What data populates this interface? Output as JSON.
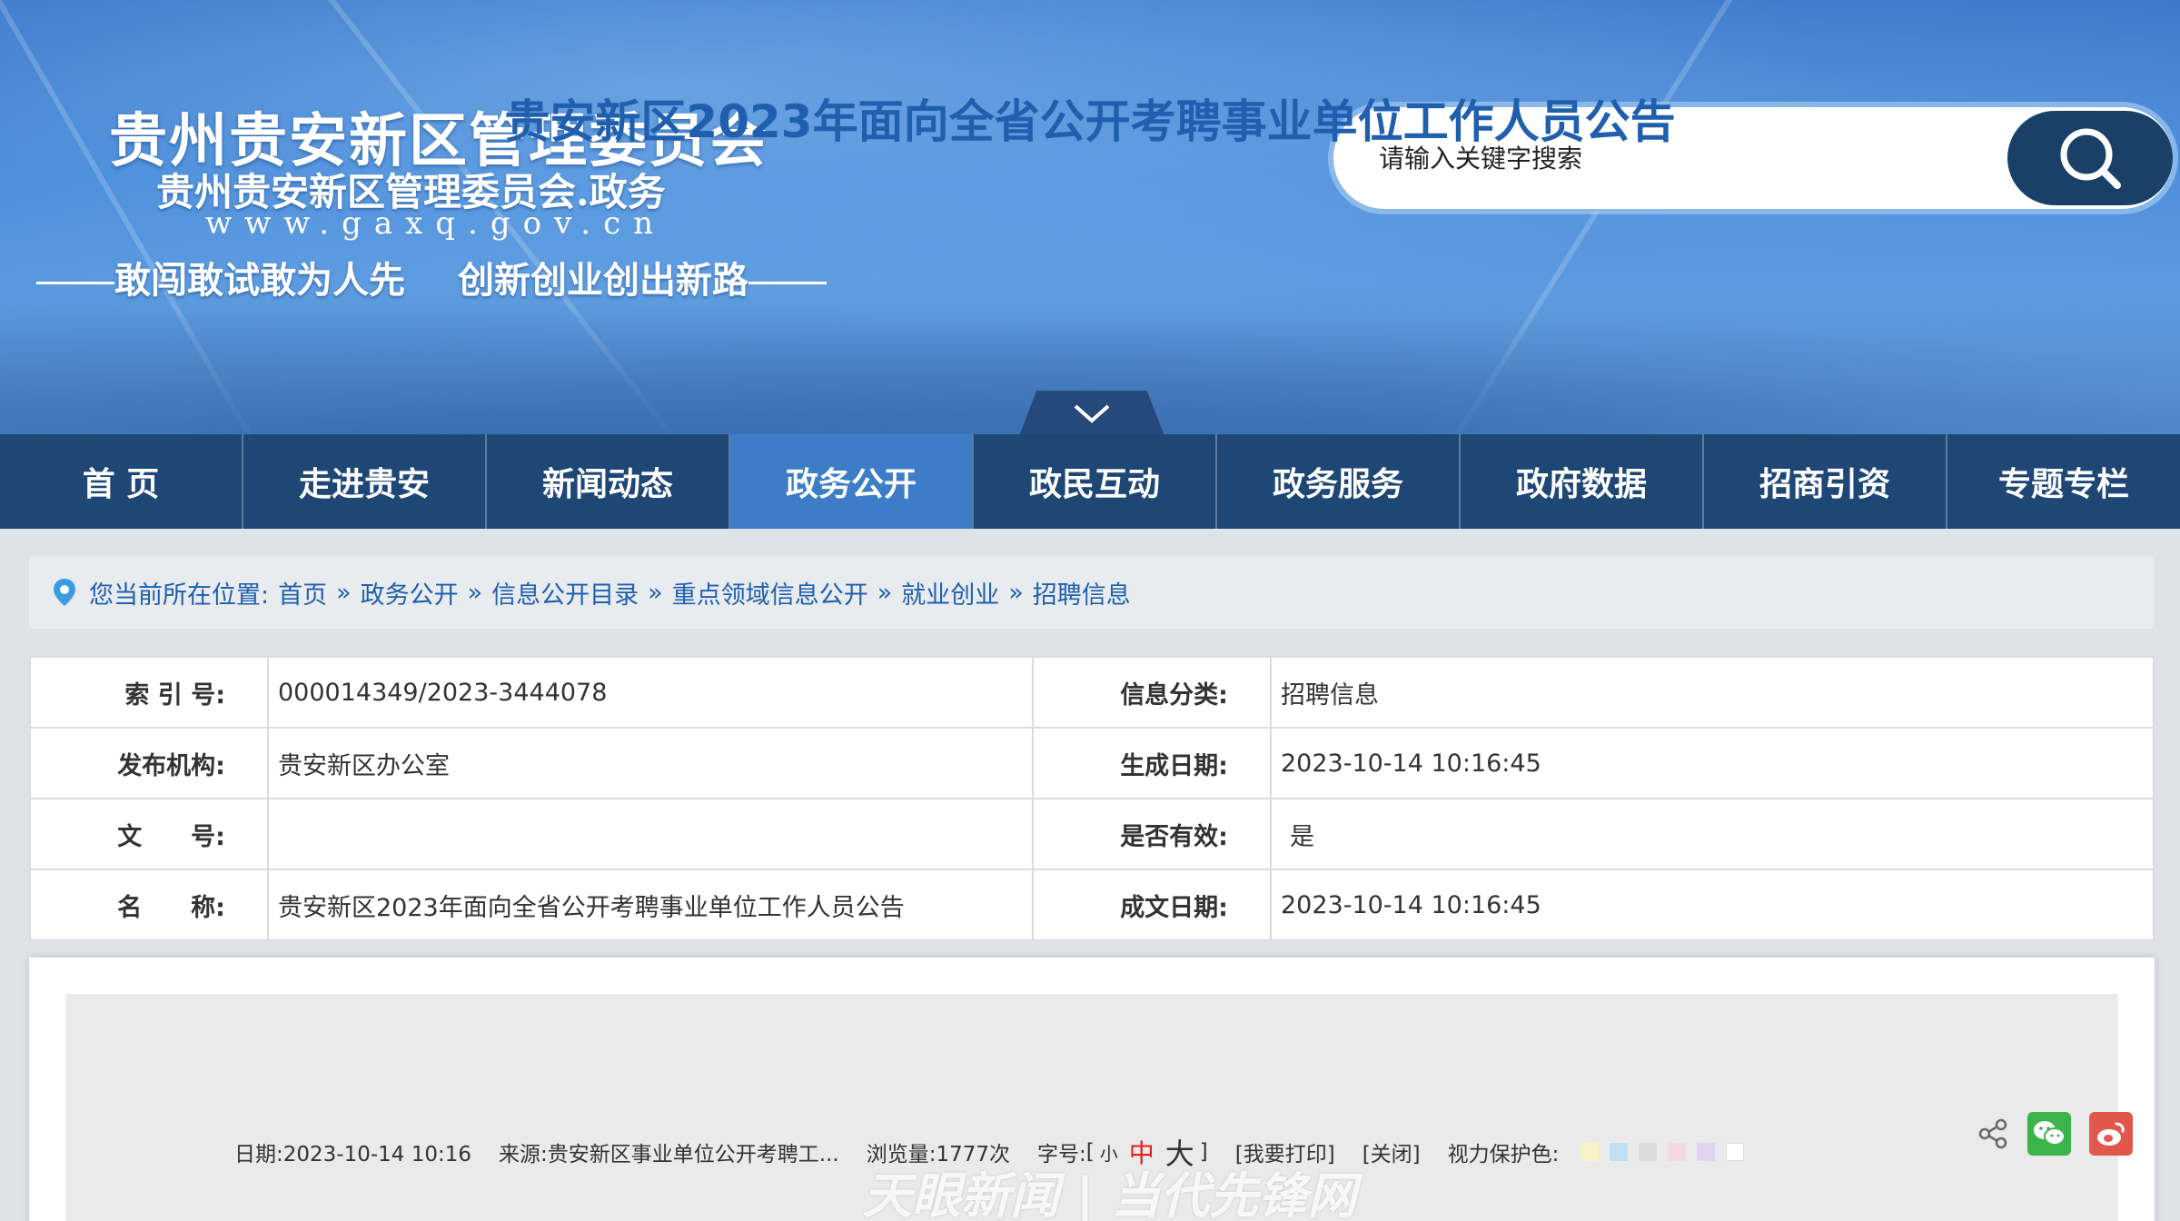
{
  "header": {
    "site_title": "贵州贵安新区管理委员会",
    "site_subtitle": "贵州贵安新区管理委员会.政务",
    "site_url": "www.gaxq.gov.cn",
    "slogan_left": "敢闯敢试敢为人先",
    "slogan_right": "创新创业创出新路"
  },
  "search": {
    "placeholder": "请输入关键字搜索",
    "button_icon": "search-icon"
  },
  "nav": {
    "items": [
      {
        "label": "首 页"
      },
      {
        "label": "走进贵安"
      },
      {
        "label": "新闻动态"
      },
      {
        "label": "政务公开",
        "active": true
      },
      {
        "label": "政民互动"
      },
      {
        "label": "政务服务"
      },
      {
        "label": "政府数据"
      },
      {
        "label": "招商引资"
      },
      {
        "label": "专题专栏"
      }
    ]
  },
  "breadcrumb": {
    "prefix": "您当前所在位置:",
    "items": [
      "首页",
      "政务公开",
      "信息公开目录",
      "重点领域信息公开",
      "就业创业",
      "招聘信息"
    ],
    "separator": "»"
  },
  "meta": {
    "index_label": "索 引 号:",
    "index_value": "000014349/2023-3444078",
    "category_label": "信息分类:",
    "category_value": "招聘信息",
    "publisher_label": "发布机构:",
    "publisher_value": "贵安新区办公室",
    "created_label": "生成日期:",
    "created_value": "2023-10-14 10:16:45",
    "docno_label": "文　　号:",
    "docno_value": "",
    "valid_label": "是否有效:",
    "valid_value": "是",
    "name_label": "名　　称:",
    "name_value": "贵安新区2023年面向全省公开考聘事业单位工作人员公告",
    "written_label": "成文日期:",
    "written_value": "2023-10-14 10:16:45"
  },
  "article": {
    "title": "贵安新区2023年面向全省公开考聘事业单位工作人员公告",
    "date_text": "日期:2023-10-14 10:16",
    "source_text": "来源:贵安新区事业单位公开考聘工...",
    "views_text": "浏览量:1777次",
    "font_label": "字号:",
    "font_open": "[",
    "font_small": "小",
    "font_mid": "中",
    "font_large": "大",
    "font_close": "]",
    "print_text": "[我要打印]",
    "close_text": "[关闭]",
    "eye_label": "视力保护色:"
  },
  "colors": {
    "nav_bg": "#1f4775",
    "nav_active": "#3d7dc8",
    "link_blue": "#1f5fae",
    "swatches": [
      "#f9f2c4",
      "#bfe0f4",
      "#dcdcdc",
      "#f6d8e0",
      "#e4d4f2",
      "#ffffff"
    ]
  },
  "watermark": "天眼新闻 | 当代先锋网"
}
